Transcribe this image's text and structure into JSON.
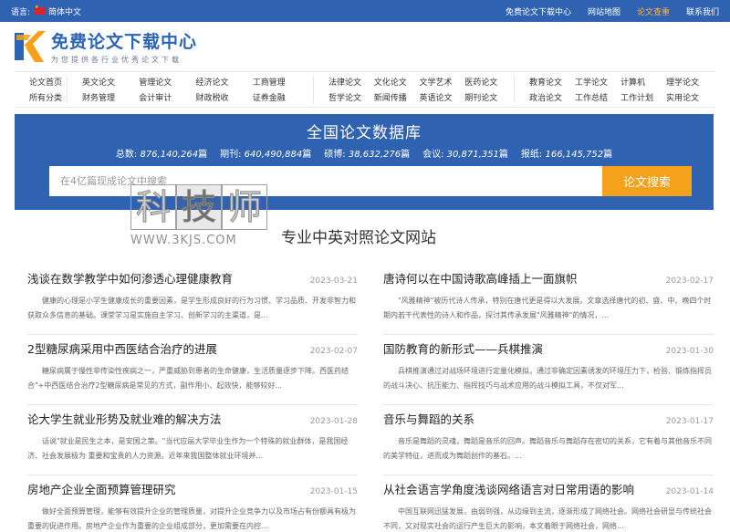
{
  "topbar": {
    "lang_label": "语言:",
    "lang_value": "简体中文",
    "links": [
      "免费论文下载中心",
      "网站地图",
      "论文查重",
      "联系我们"
    ],
    "active_index": 2,
    "accent_color": "#f8b84a"
  },
  "header": {
    "logo_icon": "stylized-K-logo",
    "site_name": "免费论文下载中心",
    "slogan": "为您提供各行业优秀论文下载"
  },
  "catnav": {
    "group1": [
      "论文首页",
      "所有分类"
    ],
    "group2": [
      "英文论文",
      "财务管理",
      "管理论文",
      "会计审计",
      "经济论文",
      "财政税收",
      "工商管理",
      "证券金融"
    ],
    "group3": [
      "法律论文",
      "哲学论文",
      "文化论文",
      "新闻传播",
      "文学艺术",
      "英语论文",
      "医药论文",
      "期刊论文"
    ],
    "group4": [
      "教育论文",
      "政治论文",
      "工学论文",
      "工作总结",
      "计算机",
      "工作计划",
      "理学论文",
      "实用论文"
    ]
  },
  "hero": {
    "title": "全国论文数据库",
    "stats": [
      {
        "label": "总数:",
        "value": "876,140,264",
        "unit": "篇"
      },
      {
        "label": "期刊:",
        "value": "640,490,884",
        "unit": "篇"
      },
      {
        "label": "硕博:",
        "value": "38,632,276",
        "unit": "篇"
      },
      {
        "label": "会议:",
        "value": "30,871,351",
        "unit": "篇"
      },
      {
        "label": "报纸:",
        "value": "166,145,752",
        "unit": "篇"
      }
    ],
    "search_placeholder": "在4亿篇现成论文中搜索",
    "search_button": "论文搜索",
    "bg_color": "#2f62b1",
    "button_color": "#f5a11c"
  },
  "watermark": {
    "chars": [
      "科",
      "技",
      "师"
    ],
    "url": "WWW.3KJS.COM"
  },
  "section_title": "专业中英对照论文网站",
  "articles": [
    {
      "title": "浅谈在数学教学中如何渗透心理健康教育",
      "date": "2023-03-21",
      "summary": "健康的心理是小学生健康成长的重要因素，是学生形成良好的行为习惯、学习品质、开发非智力和获取众多信息的基础。课堂学习是实施自主学习、创新学习的主渠道，是..."
    },
    {
      "title": "唐诗何以在中国诗歌高峰插上一面旗帜",
      "date": "2023-02-17",
      "summary": "\"风雅精神\"被历代诗人传承，特别在唐代更是得以大发展。文章选择唐代的初、盛、中、晚四个时期内若干代表性的诗人和作品，探讨其传承发展\"风雅精神\"的情况，..."
    },
    {
      "title": "2型糖尿病采用中西医结合治疗的进展",
      "date": "2023-02-07",
      "summary": "糖尿病属于慢性非传染性疾病之一，严重威胁到患者的生命健康，生活质量逐步下降。西医药结合\"+中西医结合治疗2型糖尿病是常见的方式，副作用小、起效快，能够较好..."
    },
    {
      "title": "国防教育的新形式——兵棋推演",
      "date": "2023-01-30",
      "summary": "兵棋推演通过对战场环境进行定量化模拟，通过非确定因素诱发的环境压力下，检验、锻炼指挥员的战斗决心、抗压能力、指挥技巧与战术应用的战斗模拟工具，不仅对军..."
    },
    {
      "title": "论大学生就业形势及就业难的解决方法",
      "date": "2023-01-28",
      "summary": "话说\"就业是民生之本，是安国之策。\"当代应届大学毕业生作为一个特殊的就业群体，是我国经济、社会发展极为 重要和宝贵的人力资源。近年来我国整体就业环境并..."
    },
    {
      "title": "音乐与舞蹈的关系",
      "date": "2023-01-17",
      "summary": "音乐是舞蹈的灵魂，舞蹈是音乐的回声。舞蹈音乐与舞蹈存在密切的关系，它有着与其他音乐不同的美学特征，进而成为舞蹈创作的基石。..."
    },
    {
      "title": "房地产企业全面预算管理研究",
      "date": "2023-01-15",
      "summary": "做好全面预算管理，能够有效提升企业的管理质量，对提升企业竞争力以及市场占有份额具有极为重要的促进作用。房地产企业作为重要的企业组成部分，更加需要在内控..."
    },
    {
      "title": "从社会语言学角度浅谈网络语言对日常用语的影响",
      "date": "2023-01-14",
      "summary": "中国互联网迅猛发展，由弱到强，从边缘到主流，逐渐形成了网络社会。网络社会研显与传统社会不同，又对现实社会的运行产生巨大的影响，本文着眼于网络社会，网络..."
    }
  ]
}
